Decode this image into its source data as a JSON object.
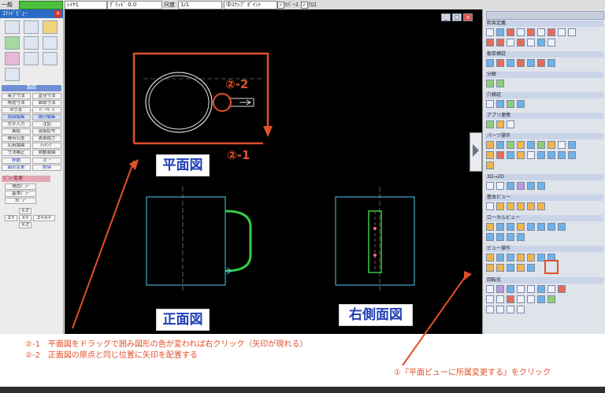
{
  "toolbar": {
    "item1": "一般",
    "layer": "ﾚｲﾔ1",
    "grid": "ｸﾞﾘｯﾄﾞ 0.0",
    "scale_label": "尺度",
    "scale_value": "1/1",
    "snap": "中ｽﾅｯﾌﾟ ﾎﾟｲﾝﾄ",
    "chk1": "ﾘﾊﾞｰｽ",
    "chk2": "ｸﾛｽ"
  },
  "left_palette": {
    "title": "ｺﾏﾝﾄﾞﾋﾞｭｰ",
    "section_drawing": "製図",
    "buttons": [
      "長さ寸法",
      "直径寸法",
      "角度寸法",
      "面取寸法",
      "R寸法",
      "ﾊﾟｰﾂﾄﾞﾙ",
      "製図編集",
      "線分編集",
      "文字入力",
      "注記",
      "風船",
      "溶接記号",
      "幾何公差",
      "表面粗さ",
      "応用製図",
      "ﾊｯﾁﾝｸﾞ",
      "寸法補正",
      "自動製図",
      "移動",
      "ｺﾋﾟｰ",
      "図形変更",
      "削除"
    ],
    "section_view": "ﾋﾞｭｰ変更",
    "view_buttons": [
      "現在ﾋﾞｭｰ",
      "基本ﾋﾞｭｰ",
      "3ﾋﾞｭｰ"
    ],
    "small_buttons": [
      "X-Z",
      "Z-Y",
      "X-Y",
      "Z-Y-X-Y",
      "X-Z"
    ]
  },
  "canvas": {
    "view_top": "平面図",
    "view_front": "正面図",
    "view_right": "右側面図",
    "mark_2_2": "②-2",
    "mark_2_1": "②-1"
  },
  "instructions": {
    "line1": "②-1　平面図をドラッグで囲み図形の色が変われば右クリック（矢印が現れる）",
    "line2": "②-2　正面図の原点と同じ位置に矢印を配置する",
    "right_note": "①『平面ビューに所属変更する』をクリック"
  },
  "right_palette": {
    "sections": [
      "和束定義",
      "板厚検証",
      "分解",
      "穴検証",
      "アプリ連携",
      "パーツ操作",
      "3D→2D",
      "基本ビュー",
      "ローカルビュー",
      "ビュー操作",
      "回転化"
    ]
  },
  "colors": {
    "accent_red": "#e2502a",
    "label_blue": "#1f3fb6",
    "outline_cyan": "#4fc7e8",
    "outline_green": "#33cc44"
  }
}
